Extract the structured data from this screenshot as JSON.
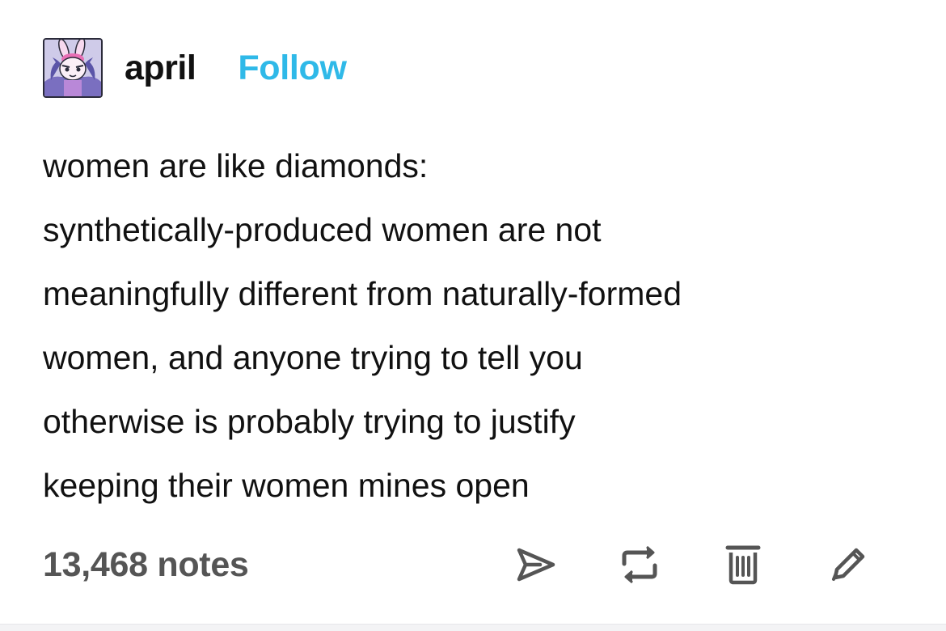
{
  "post": {
    "username": "april",
    "follow_label": "Follow",
    "avatar_icon": "bunny-character-avatar",
    "body_lines": [
      "women are like diamonds:",
      "synthetically-produced women are not",
      "meaningfully different from naturally-formed",
      "women, and anyone trying to tell you",
      "otherwise is probably trying to justify",
      "keeping their women mines open"
    ],
    "notes_count": "13,468 notes",
    "actions": [
      {
        "icon": "share-icon"
      },
      {
        "icon": "reblog-icon"
      },
      {
        "icon": "trash-icon"
      },
      {
        "icon": "edit-icon"
      }
    ],
    "colors": {
      "follow": "#2fb9e8",
      "text": "#111111",
      "notes": "#555555",
      "icons": "#555555"
    }
  }
}
